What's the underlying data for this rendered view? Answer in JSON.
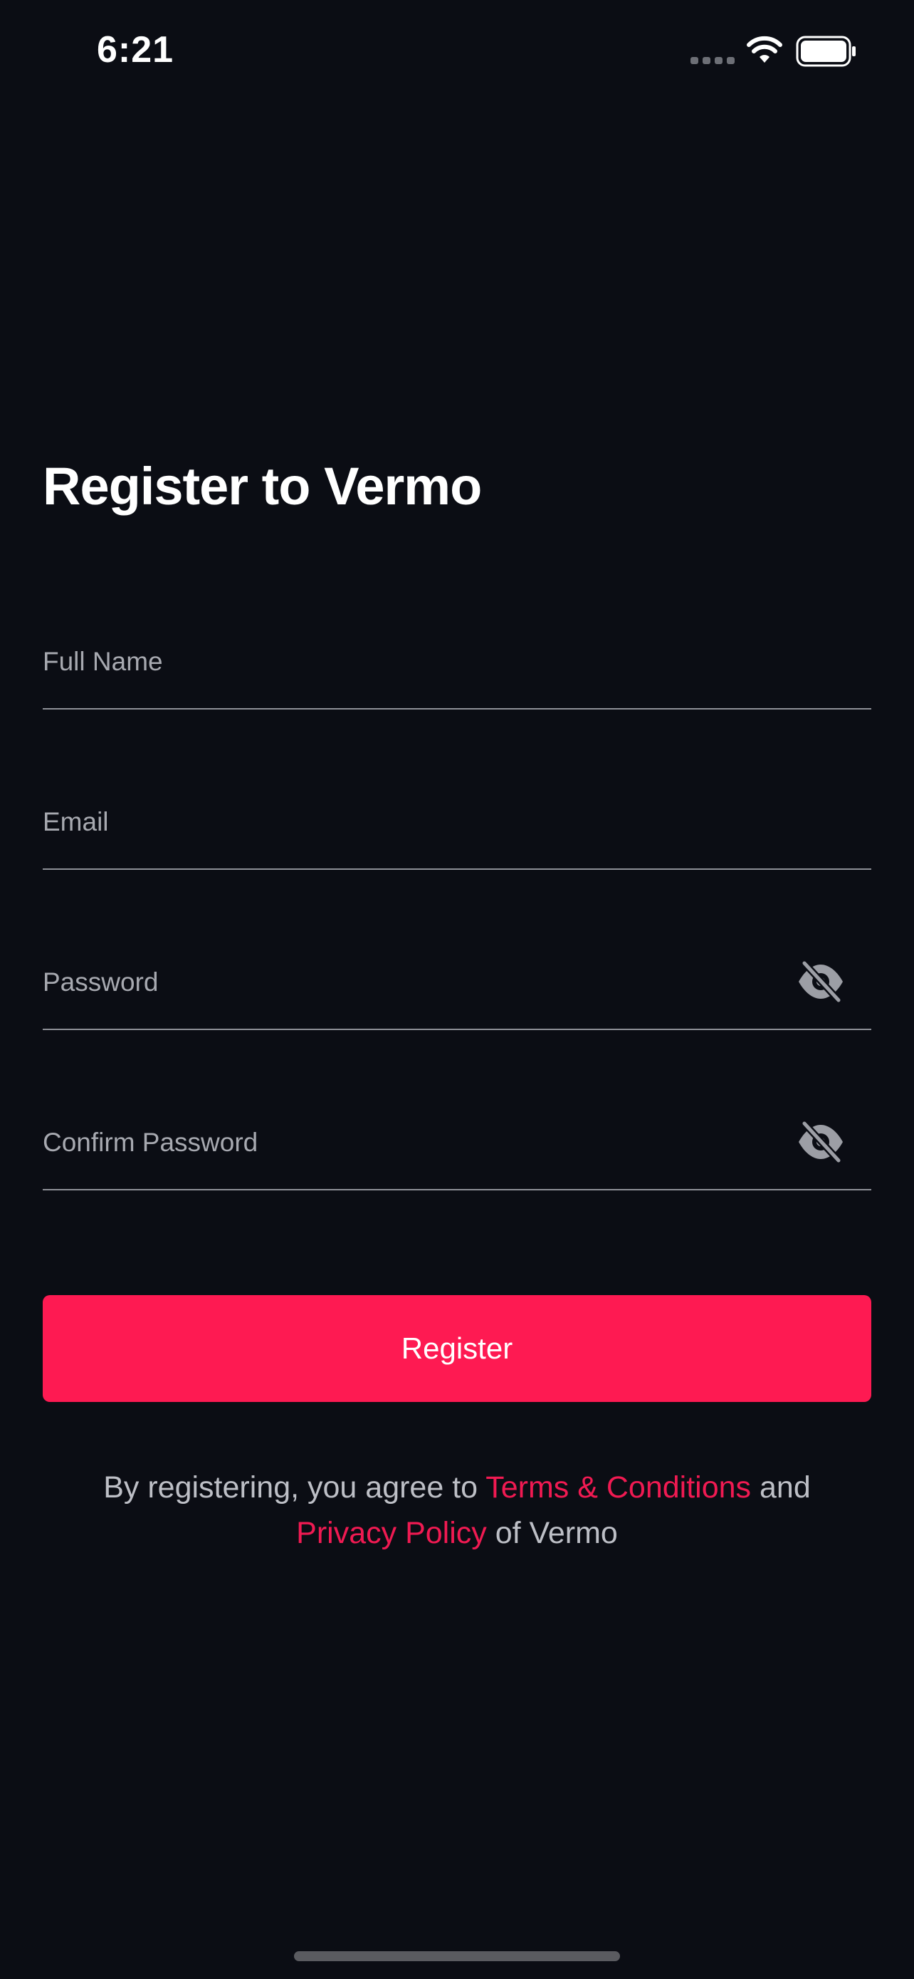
{
  "status_bar": {
    "time": "6:21"
  },
  "icons": {
    "wifi": "wifi-icon",
    "battery": "battery-full-icon",
    "signal": "cellular-signal-dots-icon",
    "password_toggle": "eye-slash-icon"
  },
  "page": {
    "title": "Register to Vermo"
  },
  "form": {
    "full_name": {
      "placeholder": "Full Name",
      "value": ""
    },
    "email": {
      "placeholder": "Email",
      "value": ""
    },
    "password": {
      "placeholder": "Password",
      "value": ""
    },
    "confirm_password": {
      "placeholder": "Confirm Password",
      "value": ""
    },
    "register_label": "Register"
  },
  "terms": {
    "prefix": "By registering, you agree to ",
    "terms_link": "Terms & Conditions",
    "middle": " and",
    "privacy_link": "Privacy Policy",
    "suffix": " of Vermo"
  },
  "colors": {
    "background": "#0b0d14",
    "accent": "#fe1a52",
    "link": "#f01a52",
    "placeholder": "#a7a9b0",
    "divider": "#8e9097",
    "muted_text": "#bdbfc6"
  }
}
